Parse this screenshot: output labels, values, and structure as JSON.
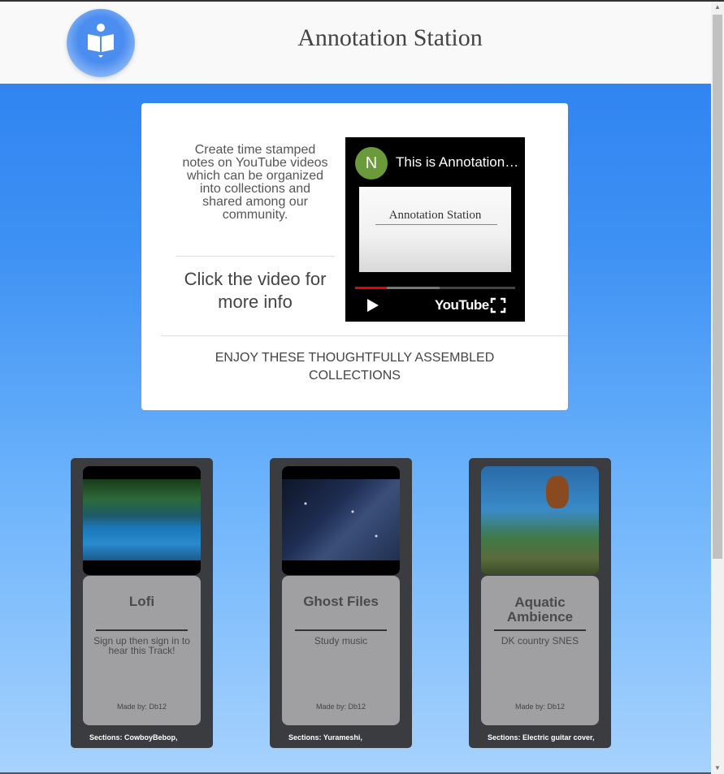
{
  "header": {
    "title": "Annotation Station",
    "logo_icon": "book-reader-icon"
  },
  "intro": {
    "description": "Create time stamped notes on YouTube videos which can be organized into collections and shared among our community.",
    "click_info": "Click the video for more info",
    "collections_heading": "ENJOY THESE THOUGHTFULLY ASSEMBLED COLLECTIONS",
    "video": {
      "channel_initial": "N",
      "title": "This is Annotation Station",
      "thumbnail_text": "Annotation Station",
      "platform": "YouTube",
      "progress_fraction": 0.2,
      "buffer_fraction": 0.53
    }
  },
  "collections": [
    {
      "name": "Lofi",
      "description": "Sign up then sign in to hear this Track!",
      "made_by": "Made by: Db12",
      "sections": "Sections: CowboyBebop,"
    },
    {
      "name": "Ghost Files",
      "description": "Study music",
      "made_by": "Made by: Db12",
      "sections": "Sections: Yurameshi,"
    },
    {
      "name": "Aquatic Ambience",
      "description": "DK country SNES",
      "made_by": "Made by: Db12",
      "sections": "Sections: Electric guitar cover,"
    }
  ],
  "colors": {
    "accent": "#2b7ff0",
    "card_dark": "#3b3c40",
    "card_body": "#a0a0a2",
    "progress": "#ee0000"
  }
}
